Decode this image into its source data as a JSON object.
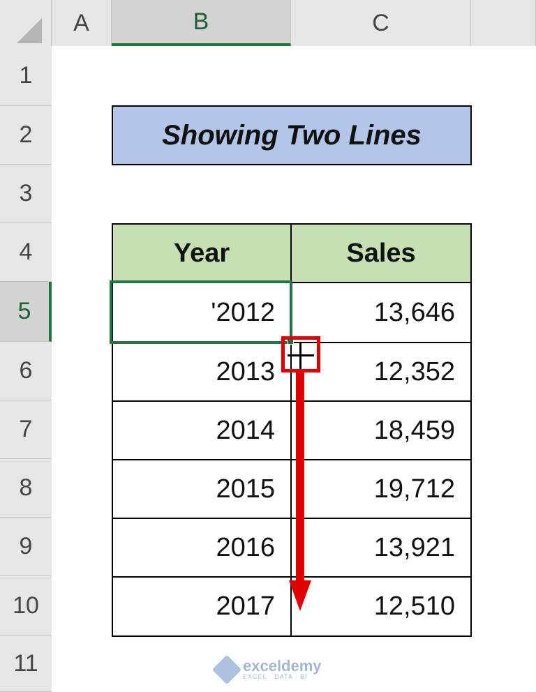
{
  "columns": [
    "A",
    "B",
    "C"
  ],
  "rows": [
    "1",
    "2",
    "3",
    "4",
    "5",
    "6",
    "7",
    "8",
    "9",
    "10",
    "11"
  ],
  "title": "Showing Two Lines",
  "table": {
    "headers": [
      "Year",
      "Sales"
    ],
    "rows": [
      [
        "'2012",
        "13,646"
      ],
      [
        "2013",
        "12,352"
      ],
      [
        "2014",
        "18,459"
      ],
      [
        "2015",
        "19,712"
      ],
      [
        "2016",
        "13,921"
      ],
      [
        "2017",
        "12,510"
      ]
    ]
  },
  "selection": {
    "active_cell": "B5"
  },
  "watermark": {
    "main": "exceldemy",
    "sub": "EXCEL · DATA · BI"
  },
  "colors": {
    "title_fill": "#b4c6e7",
    "header_fill": "#c6e0b4",
    "selection": "#217346",
    "annotation": "#e00000"
  }
}
